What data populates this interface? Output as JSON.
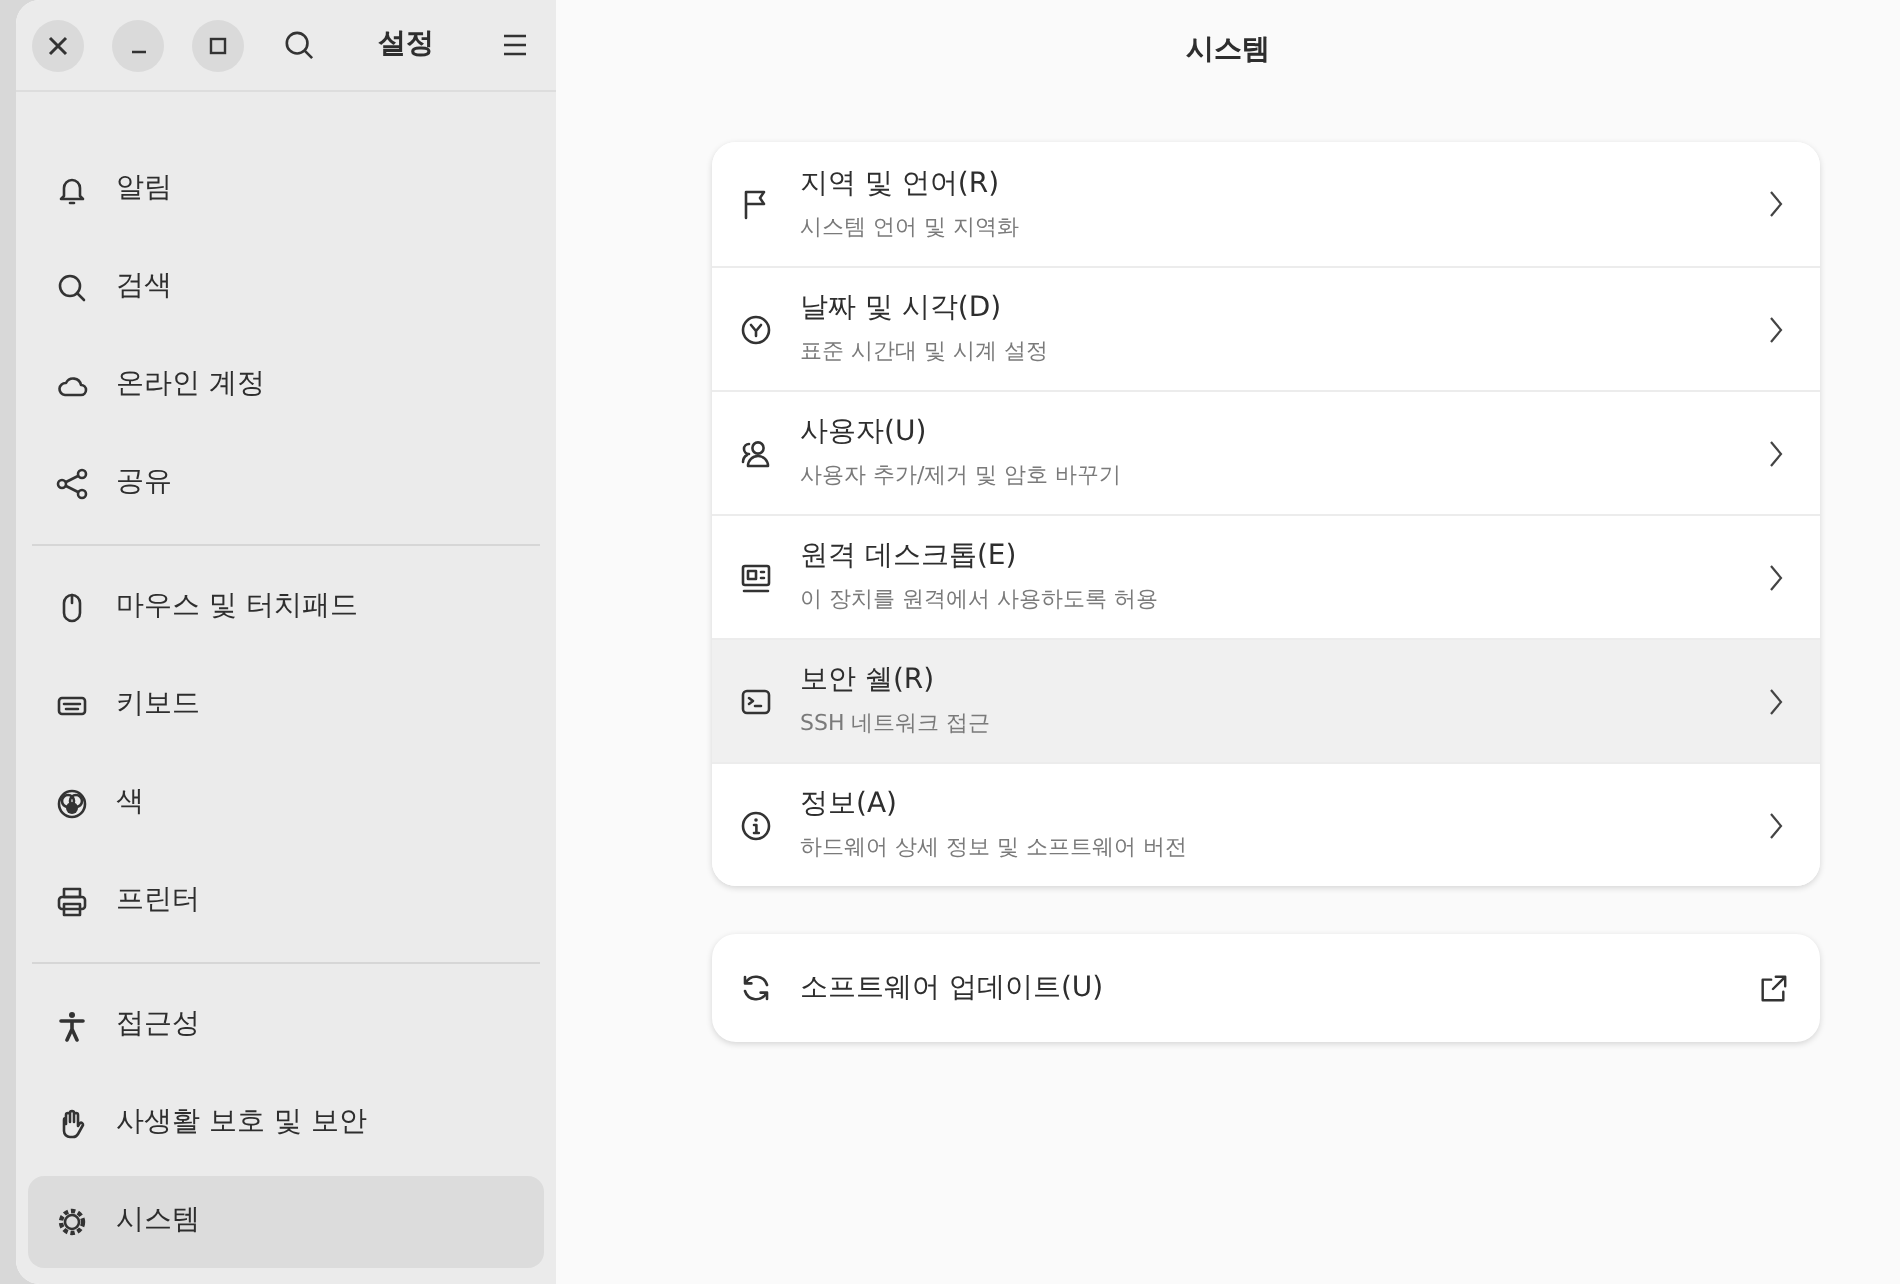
{
  "window": {
    "sidebar_title": "설정",
    "title": "시스템"
  },
  "sidebar": {
    "groups": [
      [
        {
          "label": "알림",
          "selected": false
        },
        {
          "label": "검색",
          "selected": false
        },
        {
          "label": "온라인 계정",
          "selected": false
        },
        {
          "label": "공유",
          "selected": false
        }
      ],
      [
        {
          "label": "마우스 및 터치패드",
          "selected": false
        },
        {
          "label": "키보드",
          "selected": false
        },
        {
          "label": "색",
          "selected": false
        },
        {
          "label": "프린터",
          "selected": false
        }
      ],
      [
        {
          "label": "접근성",
          "selected": false
        },
        {
          "label": "사생활 보호 및 보안",
          "selected": false
        },
        {
          "label": "시스템",
          "selected": true
        }
      ]
    ]
  },
  "rows": [
    {
      "title": "지역 및 언어(R)",
      "subtitle": "시스템 언어 및 지역화",
      "hovered": false
    },
    {
      "title": "날짜 및 시각(D)",
      "subtitle": "표준 시간대 및 시계 설정",
      "hovered": false
    },
    {
      "title": "사용자(U)",
      "subtitle": "사용자 추가/제거 및 암호 바꾸기",
      "hovered": false
    },
    {
      "title": "원격 데스크톱(E)",
      "subtitle": "이 장치를 원격에서 사용하도록 허용",
      "hovered": false
    },
    {
      "title": "보안 쉘(R)",
      "subtitle": "SSH 네트워크 접근",
      "hovered": true
    },
    {
      "title": "정보(A)",
      "subtitle": "하드웨어 상세 정보 및 소프트웨어 버전",
      "hovered": false
    }
  ],
  "update_row": {
    "title": "소프트웨어 업데이트(U)"
  }
}
